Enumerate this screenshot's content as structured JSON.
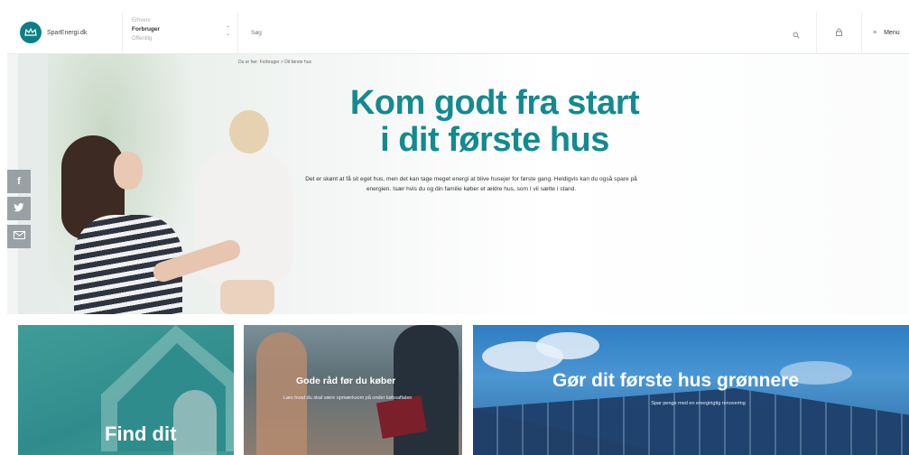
{
  "header": {
    "logo_text": "SparEnergi.dk",
    "audience": {
      "label": "Erhverv",
      "selected": "Forbruger",
      "other": "Offentlig"
    },
    "search_placeholder": "Søg",
    "menu_label": "Menu"
  },
  "colors": {
    "accent": "#138a8f",
    "logo": "#0c7f86"
  },
  "hero": {
    "breadcrumb": "Du er her: Forbruger > Dit første hus",
    "title_line1": "Kom godt fra start",
    "title_line2": "i dit første hus",
    "text": "Det er skønt at få sit eget hus, men det kan tage meget energi at blive husejer for første gang. Heldigvis kan du også spare på energien. Især hvis du og din familie køber et ældre hus, som I vil sætte i stand."
  },
  "share": {
    "facebook": "f",
    "twitter": "t",
    "email": "mail"
  },
  "cards": [
    {
      "title": "Find dit"
    },
    {
      "title": "Gode råd før du køber",
      "subtitle": "Læs hvad du skal være opmærksom på under købsaftalen"
    },
    {
      "title": "Gør dit første hus grønnere",
      "subtitle": "Spar penge med en energirigtig renovering"
    }
  ]
}
